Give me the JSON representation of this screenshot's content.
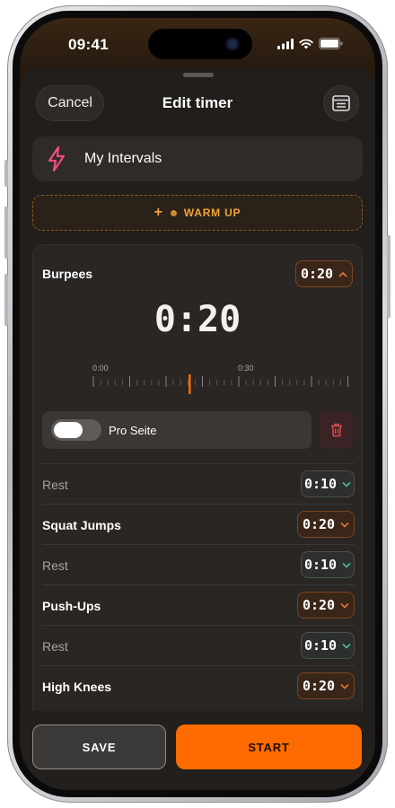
{
  "status": {
    "time": "09:41"
  },
  "nav": {
    "cancel_label": "Cancel",
    "title": "Edit timer"
  },
  "timer_name": "My Intervals",
  "warmup_label": "WARM UP",
  "current": {
    "exercise": "Burpees",
    "duration": "0:20",
    "big_time": "0:20",
    "ruler_start": "0:00",
    "ruler_mid": "0:30",
    "toggle_label": "Pro Seite",
    "toggle_on": false
  },
  "rows": [
    {
      "label": "Rest",
      "type": "rest",
      "duration": "0:10"
    },
    {
      "label": "Squat Jumps",
      "type": "exercise",
      "duration": "0:20"
    },
    {
      "label": "Rest",
      "type": "rest",
      "duration": "0:10"
    },
    {
      "label": "Push-Ups",
      "type": "exercise",
      "duration": "0:20"
    },
    {
      "label": "Rest",
      "type": "rest",
      "duration": "0:10"
    },
    {
      "label": "High Knees",
      "type": "exercise",
      "duration": "0:20"
    }
  ],
  "buttons": {
    "save": "SAVE",
    "start": "START"
  },
  "colors": {
    "accent": "#ff6b00",
    "work": "#e8743a",
    "rest": "#4fb8a0",
    "danger": "#e04a52",
    "bolt": "#ee4d7a"
  },
  "icons": [
    "lightning-icon",
    "plus-icon",
    "chevron-up-icon",
    "chevron-down-icon",
    "trash-icon",
    "menu-icon",
    "signal-icon",
    "wifi-icon",
    "battery-icon"
  ]
}
